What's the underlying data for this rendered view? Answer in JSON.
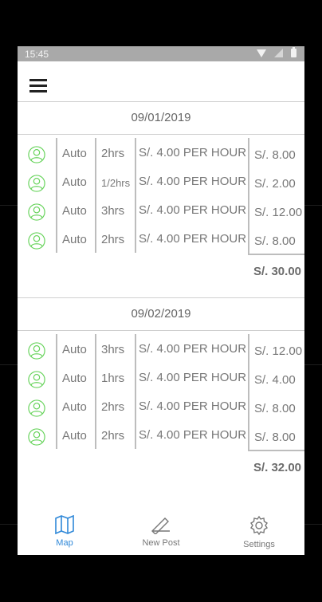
{
  "status_bar": {
    "time": "15:45"
  },
  "groups": [
    {
      "date": "09/01/2019",
      "rows": [
        {
          "vehicle": "Auto",
          "duration": "2hrs",
          "rate": "S/. 4.00 PER HOUR",
          "amount": "S/. 8.00"
        },
        {
          "vehicle": "Auto",
          "duration": "1/2hrs",
          "rate": "S/. 4.00 PER HOUR",
          "amount": "S/. 2.00"
        },
        {
          "vehicle": "Auto",
          "duration": "3hrs",
          "rate": "S/. 4.00 PER HOUR",
          "amount": "S/. 12.00"
        },
        {
          "vehicle": "Auto",
          "duration": "2hrs",
          "rate": "S/. 4.00 PER HOUR",
          "amount": "S/. 8.00"
        }
      ],
      "total": "S/. 30.00"
    },
    {
      "date": "09/02/2019",
      "rows": [
        {
          "vehicle": "Auto",
          "duration": "3hrs",
          "rate": "S/. 4.00 PER HOUR",
          "amount": "S/. 12.00"
        },
        {
          "vehicle": "Auto",
          "duration": "1hrs",
          "rate": "S/. 4.00 PER HOUR",
          "amount": "S/. 4.00"
        },
        {
          "vehicle": "Auto",
          "duration": "2hrs",
          "rate": "S/. 4.00 PER HOUR",
          "amount": "S/. 8.00"
        },
        {
          "vehicle": "Auto",
          "duration": "2hrs",
          "rate": "S/. 4.00 PER HOUR",
          "amount": "S/. 8.00"
        }
      ],
      "total": "S/. 32.00"
    }
  ],
  "tabs": [
    {
      "label": "Map",
      "icon": "map-icon",
      "active": true
    },
    {
      "label": "New Post",
      "icon": "pencil-icon",
      "active": false
    },
    {
      "label": "Settings",
      "icon": "gear-icon",
      "active": false
    }
  ],
  "colors": {
    "accent": "#2f88d8",
    "user_icon": "#66d35a",
    "status_bar": "#a9a9a9"
  }
}
